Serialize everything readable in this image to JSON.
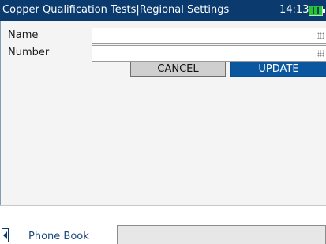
{
  "titlebar": {
    "title": "Copper Qualification Tests|Regional Settings",
    "time": "14:13",
    "battery_icon": "battery-charging-icon"
  },
  "form": {
    "name_label": "Name",
    "name_value": "",
    "number_label": "Number",
    "number_value": "",
    "keyboard_icon": "keyboard-icon"
  },
  "buttons": {
    "cancel_label": "CANCEL",
    "update_label": "UPDATE"
  },
  "tabs": {
    "active_label": "Phone Book",
    "back_icon": "left-arrow-icon"
  },
  "colors": {
    "titlebar": "#0a3a6e",
    "update_button": "#0a57a0",
    "cancel_button": "#cfcfcf",
    "battery": "#22c72f"
  }
}
